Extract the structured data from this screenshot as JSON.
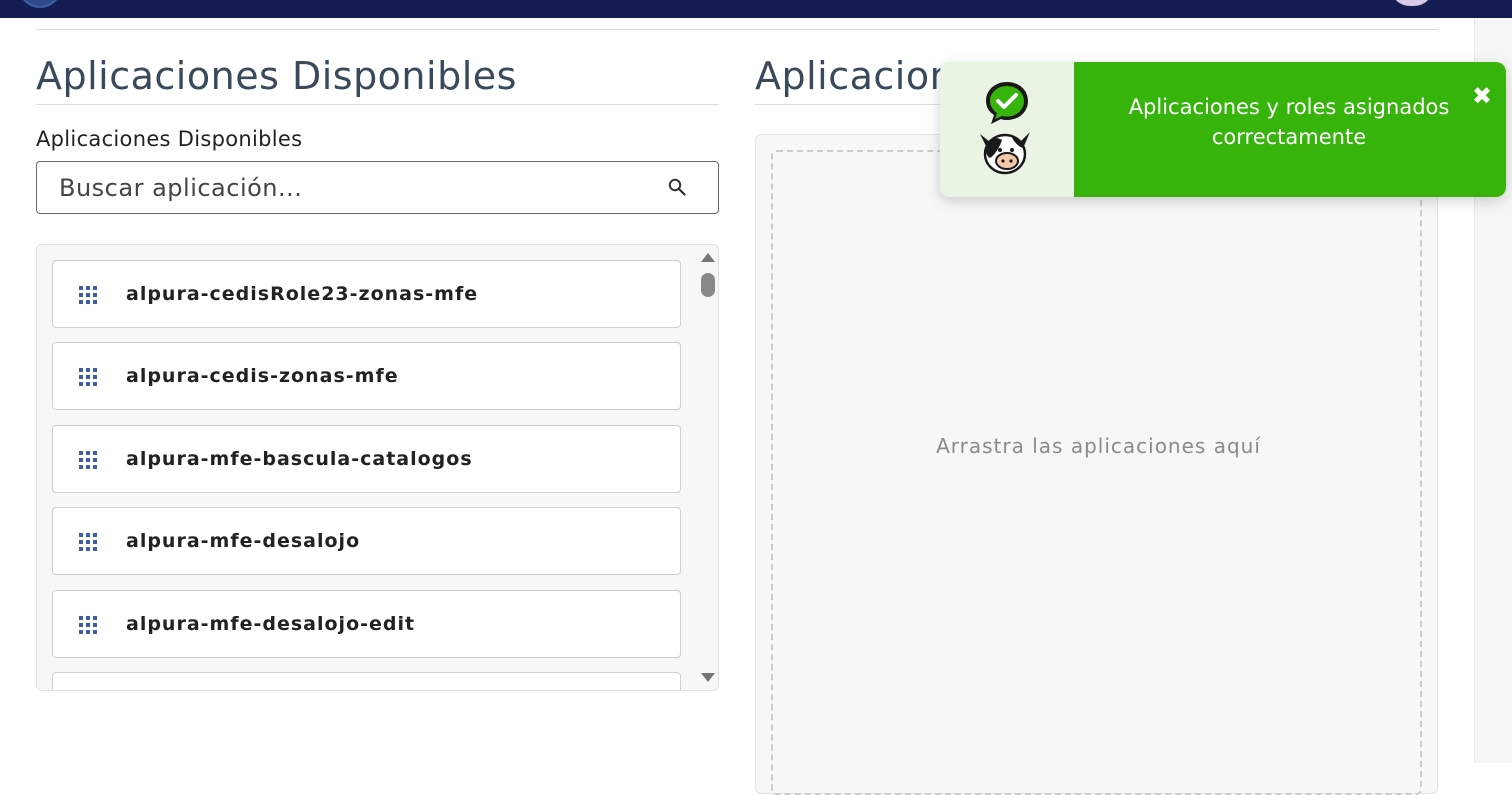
{
  "header": {
    "brand_color": "#141c52"
  },
  "left": {
    "title": "Aplicaciones Disponibles",
    "field_label": "Aplicaciones Disponibles",
    "search_placeholder": "Buscar aplicación...",
    "items": [
      {
        "label": "alpura-cedisRole23-zonas-mfe"
      },
      {
        "label": "alpura-cedis-zonas-mfe"
      },
      {
        "label": "alpura-mfe-bascula-catalogos"
      },
      {
        "label": "alpura-mfe-desalojo"
      },
      {
        "label": "alpura-mfe-desalojo-edit"
      }
    ]
  },
  "right": {
    "title": "Aplicacion",
    "drop_text": "Arrastra las aplicaciones aquí"
  },
  "toast": {
    "message": "Aplicaciones y roles asignados correctamente",
    "close_label": "✖",
    "success_color": "#37b40c"
  }
}
